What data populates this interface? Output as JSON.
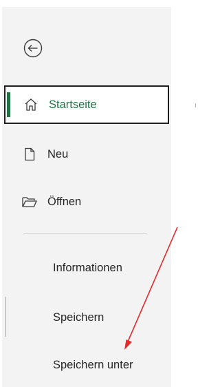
{
  "nav": {
    "back_icon": "back-arrow-circle-icon",
    "items": [
      {
        "label": "Startseite",
        "icon": "home-icon",
        "selected": true
      },
      {
        "label": "Neu",
        "icon": "new-document-icon"
      },
      {
        "label": "Öffnen",
        "icon": "open-folder-icon"
      }
    ],
    "text_items": [
      {
        "label": "Informationen"
      },
      {
        "label": "Speichern"
      },
      {
        "label": "Speichern unter"
      }
    ]
  },
  "colors": {
    "accent": "#217346",
    "nav_background": "#f3f3f3",
    "annotation_arrow": "#e8282b"
  }
}
